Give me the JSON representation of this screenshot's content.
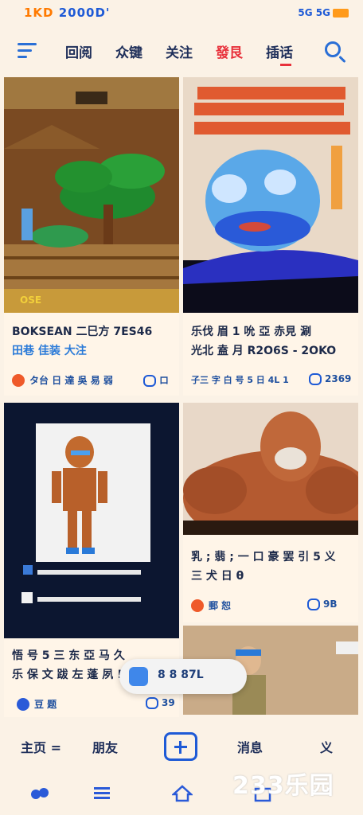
{
  "status": {
    "time_orange": "1KD ",
    "time_blue": "2000D'",
    "indicators": "5G 5G"
  },
  "topnav": {
    "tabs": [
      {
        "label": "回阅",
        "active": false
      },
      {
        "label": "众键",
        "active": false
      },
      {
        "label": "关注",
        "active": false
      },
      {
        "label": "發艮",
        "active": true
      },
      {
        "label": "插话",
        "active": false
      }
    ]
  },
  "feed": [
    {
      "title_line1": "BOKSEAN 二巳方 7ES46",
      "title_line2": "田巷 佳装 大注",
      "author": "タ台 日 達 吳 易 弱",
      "likes": "ロ"
    },
    {
      "title_line1": "乐伐 眉 1 吮 亞 赤見 涮",
      "title_line2": "光北 盍 月 R2O6S - 2OKO",
      "author": "子三 字 白 号 5 日 4L 1",
      "likes": "2369"
    },
    {
      "title_line1": "悟 号 5 三 东 亞 马 久",
      "title_line2": "乐 保 文 跋 左 蓬 夙 !",
      "author": "豆 题",
      "likes": "39"
    },
    {
      "title_line1": "乳 ; 翡 ; 一 口 豪 罢 引 5 义",
      "title_line2": "三 犬 日 θ",
      "author": "郵 恕",
      "likes": "9B"
    }
  ],
  "toast": {
    "text": "8 8 87L"
  },
  "bottom_bar": {
    "home": "主页 =",
    "friends": "朋友",
    "messages": "消息",
    "me": "义"
  },
  "watermark": "233乐园"
}
